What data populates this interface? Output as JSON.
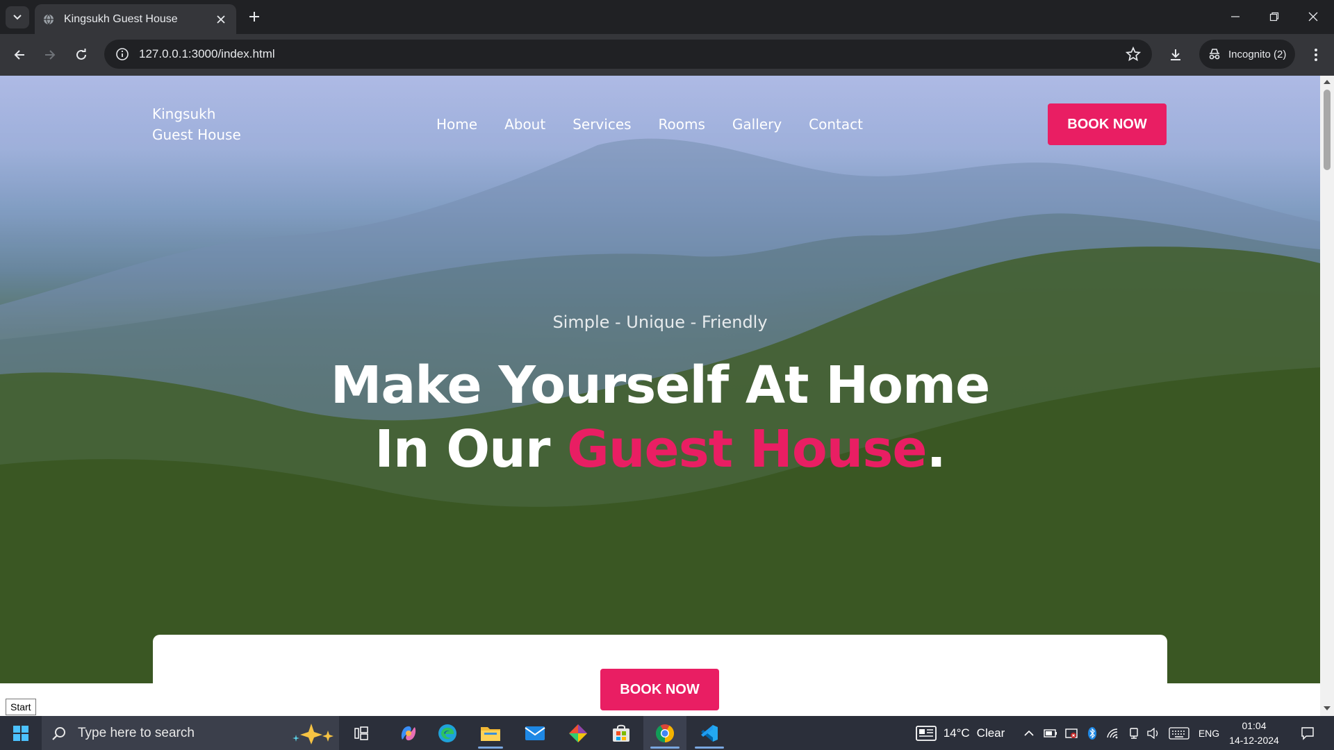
{
  "browser": {
    "tab_title": "Kingsukh Guest House",
    "url": "127.0.0.1:3000/index.html",
    "incognito_label": "Incognito (2)"
  },
  "site": {
    "brand_line1": "Kingsukh",
    "brand_line2": "Guest House",
    "nav": [
      {
        "label": "Home"
      },
      {
        "label": "About"
      },
      {
        "label": "Services"
      },
      {
        "label": "Rooms"
      },
      {
        "label": "Gallery"
      },
      {
        "label": "Contact"
      }
    ],
    "book_now_label": "BOOK NOW",
    "tagline": "Simple - Unique - Friendly",
    "headline_line1": "Make Yourself At Home",
    "headline_line2_prefix": "In Our ",
    "headline_line2_accent": "Guest House",
    "headline_line2_suffix": ".",
    "card_book_label": "BOOK NOW",
    "accent_color": "#e91e63"
  },
  "tooltip": {
    "start": "Start"
  },
  "taskbar": {
    "search_placeholder": "Type here to search",
    "weather_temp": "14°C",
    "weather_desc": "Clear",
    "language": "ENG",
    "time": "01:04",
    "date": "14-12-2024"
  }
}
